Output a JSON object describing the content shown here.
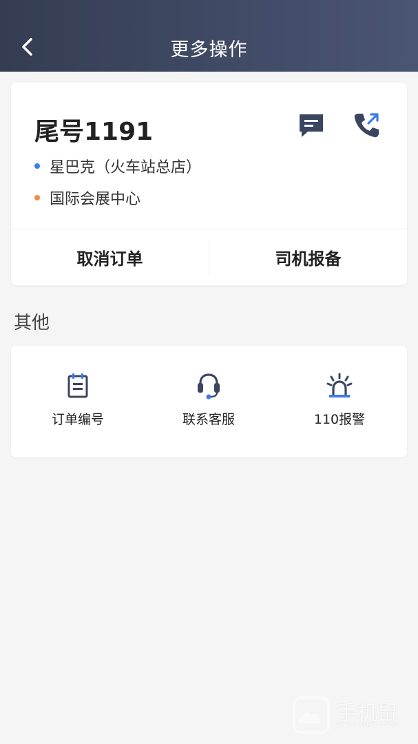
{
  "header": {
    "title": "更多操作",
    "back_icon": "chevron-left-icon"
  },
  "order": {
    "tail_number": "尾号1191",
    "start_location": "星巴克（火车站总店）",
    "end_location": "国际会展中心",
    "start_dot_color": "#3a7bf0",
    "end_dot_color": "#f28c4a",
    "message_icon": "message-icon",
    "call_icon": "phone-call-icon",
    "cancel_label": "取消订单",
    "report_label": "司机报备"
  },
  "other": {
    "section_title": "其他",
    "tools": [
      {
        "label": "订单编号",
        "icon": "order-number-icon"
      },
      {
        "label": "联系客服",
        "icon": "headset-icon"
      },
      {
        "label": "110报警",
        "icon": "alarm-icon"
      }
    ]
  },
  "watermark": {
    "main": "手机鼠",
    "sub": "SHOUJISHU.COM"
  },
  "colors": {
    "header_start": "#343d52",
    "header_end": "#4a5574",
    "icon_dark": "#3a4560",
    "accent_blue": "#3a7bf0",
    "background": "#f5f5f5"
  }
}
